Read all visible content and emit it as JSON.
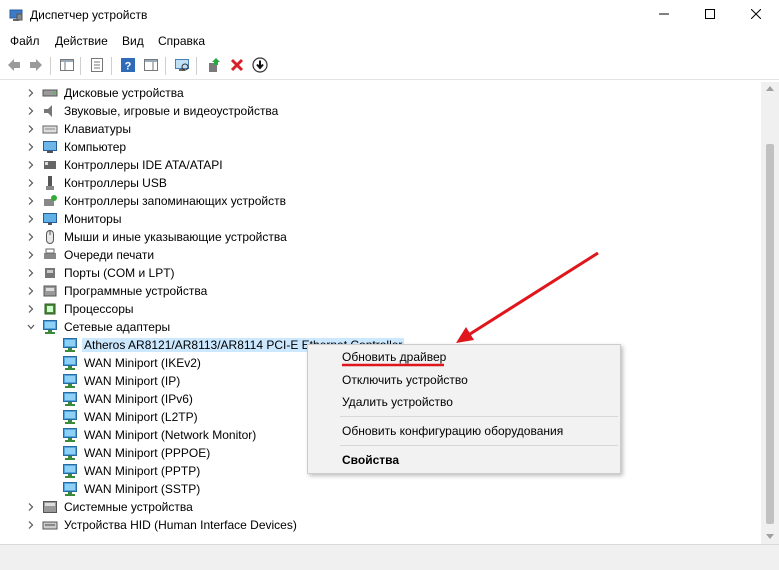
{
  "window": {
    "title": "Диспетчер устройств",
    "icon": "device-manager-icon",
    "controls": [
      "minimize-icon",
      "maximize-icon",
      "close-icon"
    ]
  },
  "menu": {
    "file": "Файл",
    "action": "Действие",
    "view": "Вид",
    "help": "Справка"
  },
  "toolbar": {
    "buttons": [
      "back-arrow-icon",
      "forward-arrow-icon",
      "show-hide-tree-icon",
      "properties-icon",
      "help-icon",
      "action-pane-icon",
      "scan-hardware-icon",
      "update-driver-icon",
      "uninstall-device-icon",
      "download-driver-icon"
    ]
  },
  "tree": {
    "items": [
      {
        "label": "Дисковые устройства",
        "icon": "disk-drive-icon"
      },
      {
        "label": "Звуковые, игровые и видеоустройства",
        "icon": "speaker-icon"
      },
      {
        "label": "Клавиатуры",
        "icon": "keyboard-icon"
      },
      {
        "label": "Компьютер",
        "icon": "computer-icon"
      },
      {
        "label": "Контроллеры IDE ATA/ATAPI",
        "icon": "ide-controller-icon"
      },
      {
        "label": "Контроллеры USB",
        "icon": "usb-icon"
      },
      {
        "label": "Контроллеры запоминающих устройств",
        "icon": "storage-controller-icon"
      },
      {
        "label": "Мониторы",
        "icon": "monitor-icon"
      },
      {
        "label": "Мыши и иные указывающие устройства",
        "icon": "mouse-icon"
      },
      {
        "label": "Очереди печати",
        "icon": "printer-icon"
      },
      {
        "label": "Порты (COM и LPT)",
        "icon": "port-icon"
      },
      {
        "label": "Программные устройства",
        "icon": "software-device-icon"
      },
      {
        "label": "Процессоры",
        "icon": "processor-icon"
      },
      {
        "label": "Сетевые адаптеры",
        "icon": "network-adapter-icon",
        "expanded": true
      },
      {
        "label": "Atheros AR8121/AR8113/AR8114 PCI-E Ethernet Controller",
        "icon": "network-adapter-icon",
        "child": true,
        "selected": true
      },
      {
        "label": "WAN Miniport (IKEv2)",
        "icon": "network-adapter-icon",
        "child": true
      },
      {
        "label": "WAN Miniport (IP)",
        "icon": "network-adapter-icon",
        "child": true
      },
      {
        "label": "WAN Miniport (IPv6)",
        "icon": "network-adapter-icon",
        "child": true
      },
      {
        "label": "WAN Miniport (L2TP)",
        "icon": "network-adapter-icon",
        "child": true
      },
      {
        "label": "WAN Miniport (Network Monitor)",
        "icon": "network-adapter-icon",
        "child": true
      },
      {
        "label": "WAN Miniport (PPPOE)",
        "icon": "network-adapter-icon",
        "child": true
      },
      {
        "label": "WAN Miniport (PPTP)",
        "icon": "network-adapter-icon",
        "child": true
      },
      {
        "label": "WAN Miniport (SSTP)",
        "icon": "network-adapter-icon",
        "child": true
      },
      {
        "label": "Системные устройства",
        "icon": "system-device-icon"
      },
      {
        "label": "Устройства HID (Human Interface Devices)",
        "icon": "hid-icon"
      }
    ]
  },
  "context_menu": {
    "update_driver": "Обновить драйвер",
    "disable_device": "Отключить устройство",
    "uninstall_device": "Удалить устройство",
    "scan_hardware": "Обновить конфигурацию оборудования",
    "properties": "Свойства"
  },
  "colors": {
    "selection": "#cce8ff",
    "annotation": "#e0161d",
    "menu_bg": "#f2f2f2"
  }
}
